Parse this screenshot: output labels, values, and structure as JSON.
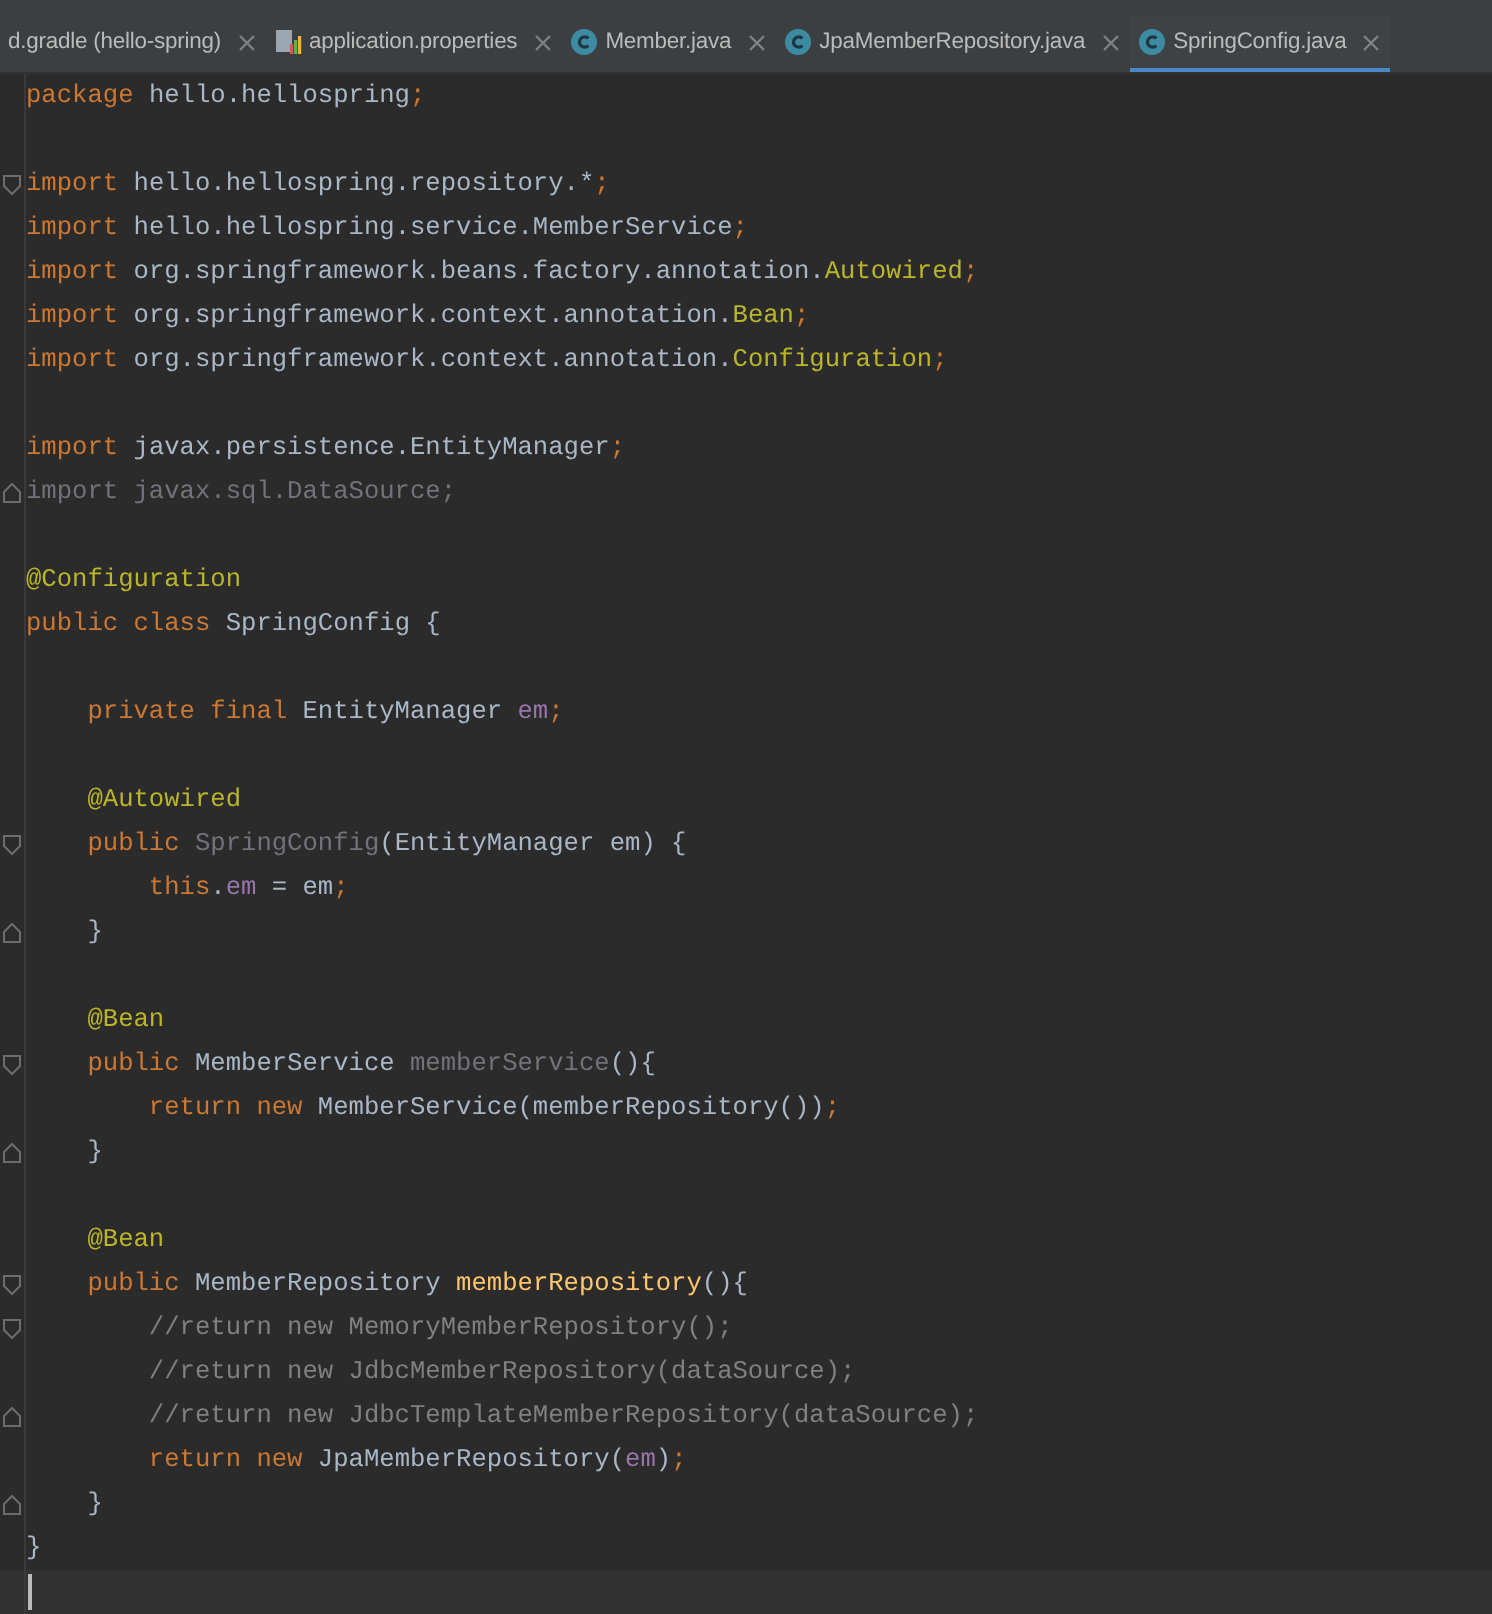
{
  "tabs": [
    {
      "label": "d.gradle (hello-spring)",
      "kind": "plain",
      "selected": false
    },
    {
      "label": "application.properties",
      "kind": "properties",
      "selected": false
    },
    {
      "label": "Member.java",
      "kind": "class",
      "selected": false
    },
    {
      "label": "JpaMemberRepository.java",
      "kind": "class",
      "selected": false
    },
    {
      "label": "SpringConfig.java",
      "kind": "class",
      "selected": true
    }
  ],
  "editor": {
    "lines": [
      {
        "kind": "code",
        "tokens": [
          {
            "kind": "kw",
            "text": "package "
          },
          {
            "kind": "plain",
            "text": "hello.hellospring"
          },
          {
            "kind": "kw",
            "text": ";"
          }
        ]
      },
      {
        "kind": "blank"
      },
      {
        "kind": "opener",
        "tokens": [
          {
            "kind": "kw",
            "text": "import "
          },
          {
            "kind": "plain",
            "text": "hello.hellospring.repository.*"
          },
          {
            "kind": "kw",
            "text": ";"
          }
        ]
      },
      {
        "kind": "code",
        "tokens": [
          {
            "kind": "kw",
            "text": "import "
          },
          {
            "kind": "plain",
            "text": "hello.hellospring.service.MemberService"
          },
          {
            "kind": "kw",
            "text": ";"
          }
        ]
      },
      {
        "kind": "code",
        "tokens": [
          {
            "kind": "kw",
            "text": "import "
          },
          {
            "kind": "plain",
            "text": "org.springframework.beans.factory.annotation."
          },
          {
            "kind": "ann",
            "text": "Autowired"
          },
          {
            "kind": "kw",
            "text": ";"
          }
        ]
      },
      {
        "kind": "code",
        "tokens": [
          {
            "kind": "kw",
            "text": "import "
          },
          {
            "kind": "plain",
            "text": "org.springframework.context.annotation."
          },
          {
            "kind": "ann",
            "text": "Bean"
          },
          {
            "kind": "kw",
            "text": ";"
          }
        ]
      },
      {
        "kind": "code",
        "tokens": [
          {
            "kind": "kw",
            "text": "import "
          },
          {
            "kind": "plain",
            "text": "org.springframework.context.annotation."
          },
          {
            "kind": "ann",
            "text": "Configuration"
          },
          {
            "kind": "kw",
            "text": ";"
          }
        ]
      },
      {
        "kind": "blank"
      },
      {
        "kind": "code",
        "tokens": [
          {
            "kind": "kw",
            "text": "import "
          },
          {
            "kind": "plain",
            "text": "javax.persistence.EntityManager"
          },
          {
            "kind": "kw",
            "text": ";"
          }
        ]
      },
      {
        "kind": "closer",
        "tokens": [
          {
            "kind": "unused",
            "text": "import javax.sql.DataSource;"
          }
        ]
      },
      {
        "kind": "blank"
      },
      {
        "kind": "code",
        "tokens": [
          {
            "kind": "ann",
            "text": "@Configuration"
          }
        ]
      },
      {
        "kind": "code",
        "tokens": [
          {
            "kind": "kw",
            "text": "public class "
          },
          {
            "kind": "plain",
            "text": "SpringConfig {"
          }
        ]
      },
      {
        "kind": "blank"
      },
      {
        "kind": "code",
        "tokens": [
          {
            "kind": "kw",
            "text": "    private final "
          },
          {
            "kind": "plain",
            "text": "EntityManager "
          },
          {
            "kind": "field",
            "text": "em"
          },
          {
            "kind": "kw",
            "text": ";"
          }
        ]
      },
      {
        "kind": "blank"
      },
      {
        "kind": "code",
        "tokens": [
          {
            "kind": "ann",
            "text": "    @Autowired"
          }
        ]
      },
      {
        "kind": "opener",
        "tokens": [
          {
            "kind": "kw",
            "text": "    public "
          },
          {
            "kind": "unused",
            "text": "SpringConfig"
          },
          {
            "kind": "plain",
            "text": "(EntityManager em) {"
          }
        ]
      },
      {
        "kind": "code",
        "tokens": [
          {
            "kind": "kw",
            "text": "        this"
          },
          {
            "kind": "plain",
            "text": "."
          },
          {
            "kind": "field",
            "text": "em"
          },
          {
            "kind": "plain",
            "text": " = em"
          },
          {
            "kind": "kw",
            "text": ";"
          }
        ]
      },
      {
        "kind": "closer",
        "tokens": [
          {
            "kind": "plain",
            "text": "    }"
          }
        ]
      },
      {
        "kind": "blank"
      },
      {
        "kind": "code",
        "tokens": [
          {
            "kind": "ann",
            "text": "    @Bean"
          }
        ]
      },
      {
        "kind": "opener",
        "tokens": [
          {
            "kind": "kw",
            "text": "    public "
          },
          {
            "kind": "plain",
            "text": "MemberService "
          },
          {
            "kind": "unused",
            "text": "memberService"
          },
          {
            "kind": "plain",
            "text": "(){"
          }
        ]
      },
      {
        "kind": "code",
        "tokens": [
          {
            "kind": "kw",
            "text": "        return new "
          },
          {
            "kind": "plain",
            "text": "MemberService(memberRepository())"
          },
          {
            "kind": "kw",
            "text": ";"
          }
        ]
      },
      {
        "kind": "closer",
        "tokens": [
          {
            "kind": "plain",
            "text": "    }"
          }
        ]
      },
      {
        "kind": "blank"
      },
      {
        "kind": "code",
        "tokens": [
          {
            "kind": "ann",
            "text": "    @Bean"
          }
        ]
      },
      {
        "kind": "opener",
        "tokens": [
          {
            "kind": "kw",
            "text": "    public "
          },
          {
            "kind": "plain",
            "text": "MemberRepository "
          },
          {
            "kind": "method",
            "text": "memberRepository"
          },
          {
            "kind": "plain",
            "text": "(){"
          }
        ]
      },
      {
        "kind": "opener",
        "tokens": [
          {
            "kind": "comment",
            "text": "        //return new MemoryMemberRepository();"
          }
        ]
      },
      {
        "kind": "code",
        "tokens": [
          {
            "kind": "comment",
            "text": "        //return new JdbcMemberRepository(dataSource);"
          }
        ]
      },
      {
        "kind": "closer",
        "tokens": [
          {
            "kind": "comment",
            "text": "        //return new JdbcTemplateMemberRepository(dataSource);"
          }
        ]
      },
      {
        "kind": "code",
        "tokens": [
          {
            "kind": "kw",
            "text": "        return new "
          },
          {
            "kind": "plain",
            "text": "JpaMemberRepository("
          },
          {
            "kind": "field",
            "text": "em"
          },
          {
            "kind": "plain",
            "text": ")"
          },
          {
            "kind": "kw",
            "text": ";"
          }
        ]
      },
      {
        "kind": "closer",
        "tokens": [
          {
            "kind": "plain",
            "text": "    }"
          }
        ]
      },
      {
        "kind": "code",
        "tokens": [
          {
            "kind": "plain",
            "text": "}"
          }
        ]
      },
      {
        "kind": "blank",
        "current": true
      }
    ]
  }
}
